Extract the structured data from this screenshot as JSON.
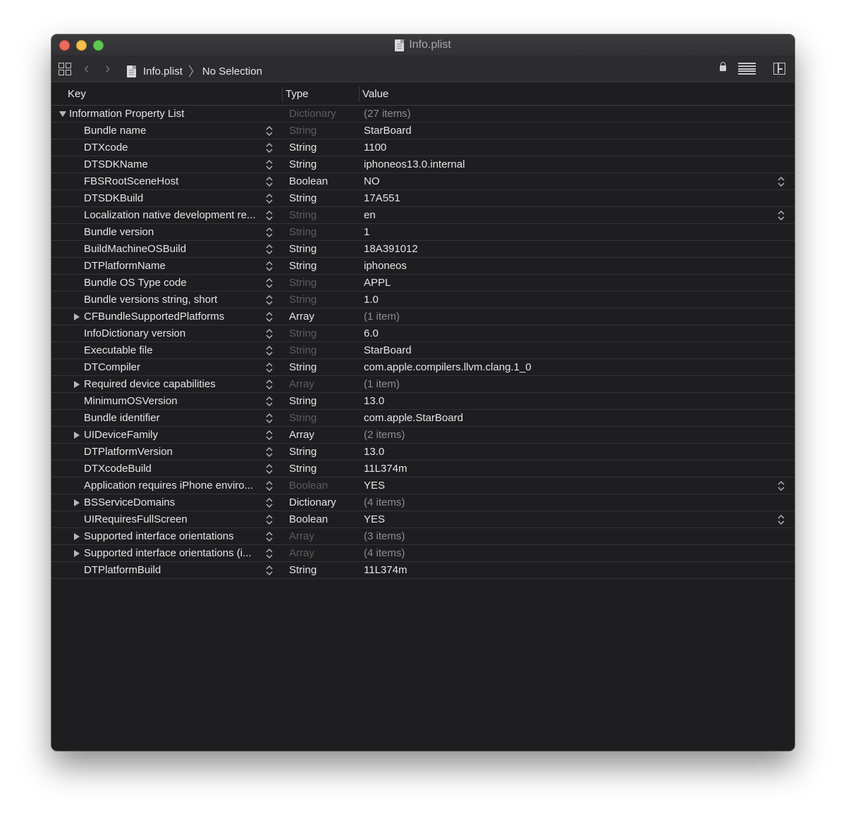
{
  "window": {
    "title": "Info.plist"
  },
  "toolbar": {
    "breadcrumb": [
      "Info.plist",
      "No Selection"
    ],
    "icons": [
      "grid-icon",
      "back-icon",
      "forward-icon",
      "lock-icon",
      "editor-lines-icon",
      "inspector-icon"
    ]
  },
  "columns": {
    "key": "Key",
    "type": "Type",
    "value": "Value"
  },
  "rows": [
    {
      "key": "Information Property List",
      "type": "Dictionary",
      "value": "(27 items)",
      "top": true,
      "type_dim": true,
      "value_meta": true,
      "expand": "open"
    },
    {
      "key": "Bundle name",
      "type": "String",
      "value": "StarBoard",
      "type_dim": true
    },
    {
      "key": "DTXcode",
      "type": "String",
      "value": "1100"
    },
    {
      "key": "DTSDKName",
      "type": "String",
      "value": "iphoneos13.0.internal"
    },
    {
      "key": "FBSRootSceneHost",
      "type": "Boolean",
      "value": "NO",
      "value_stepper": true
    },
    {
      "key": "DTSDKBuild",
      "type": "String",
      "value": "17A551"
    },
    {
      "key": "Localization native development re...",
      "type": "String",
      "value": "en",
      "type_dim": true,
      "value_stepper": true
    },
    {
      "key": "Bundle version",
      "type": "String",
      "value": "1",
      "type_dim": true
    },
    {
      "key": "BuildMachineOSBuild",
      "type": "String",
      "value": "18A391012"
    },
    {
      "key": "DTPlatformName",
      "type": "String",
      "value": "iphoneos"
    },
    {
      "key": "Bundle OS Type code",
      "type": "String",
      "value": "APPL",
      "type_dim": true
    },
    {
      "key": "Bundle versions string, short",
      "type": "String",
      "value": "1.0",
      "type_dim": true
    },
    {
      "key": "CFBundleSupportedPlatforms",
      "type": "Array",
      "value": "(1 item)",
      "value_meta": true,
      "expand": "closed"
    },
    {
      "key": "InfoDictionary version",
      "type": "String",
      "value": "6.0",
      "type_dim": true
    },
    {
      "key": "Executable file",
      "type": "String",
      "value": "StarBoard",
      "type_dim": true
    },
    {
      "key": "DTCompiler",
      "type": "String",
      "value": "com.apple.compilers.llvm.clang.1_0"
    },
    {
      "key": "Required device capabilities",
      "type": "Array",
      "value": "(1 item)",
      "type_dim": true,
      "value_meta": true,
      "expand": "closed"
    },
    {
      "key": "MinimumOSVersion",
      "type": "String",
      "value": "13.0"
    },
    {
      "key": "Bundle identifier",
      "type": "String",
      "value": "com.apple.StarBoard",
      "type_dim": true
    },
    {
      "key": "UIDeviceFamily",
      "type": "Array",
      "value": "(2 items)",
      "value_meta": true,
      "expand": "closed"
    },
    {
      "key": "DTPlatformVersion",
      "type": "String",
      "value": "13.0"
    },
    {
      "key": "DTXcodeBuild",
      "type": "String",
      "value": "11L374m"
    },
    {
      "key": "Application requires iPhone enviro...",
      "type": "Boolean",
      "value": "YES",
      "type_dim": true,
      "value_stepper": true
    },
    {
      "key": "BSServiceDomains",
      "type": "Dictionary",
      "value": "(4 items)",
      "value_meta": true,
      "expand": "closed"
    },
    {
      "key": "UIRequiresFullScreen",
      "type": "Boolean",
      "value": "YES",
      "value_stepper": true
    },
    {
      "key": "Supported interface orientations",
      "type": "Array",
      "value": "(3 items)",
      "type_dim": true,
      "value_meta": true,
      "expand": "closed"
    },
    {
      "key": "Supported interface orientations (i...",
      "type": "Array",
      "value": "(4 items)",
      "type_dim": true,
      "value_meta": true,
      "expand": "closed"
    },
    {
      "key": "DTPlatformBuild",
      "type": "String",
      "value": "11L374m"
    }
  ]
}
